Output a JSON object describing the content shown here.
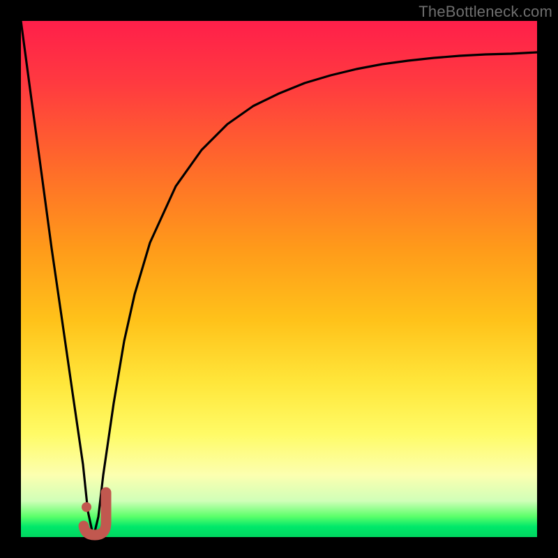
{
  "watermark": "TheBottleneck.com",
  "colors": {
    "frame": "#000000",
    "curve": "#000000",
    "marker": "#c1584f",
    "gradient_top": "#ff1f4a",
    "gradient_bottom": "#00d660"
  },
  "chart_data": {
    "type": "line",
    "title": "",
    "xlabel": "",
    "ylabel": "",
    "xlim": [
      0,
      100
    ],
    "ylim": [
      0,
      100
    ],
    "grid": false,
    "legend": false,
    "series": [
      {
        "name": "bottleneck-curve",
        "x": [
          0,
          2,
          4,
          6,
          8,
          10,
          12,
          13,
          14,
          15,
          16,
          18,
          20,
          22,
          25,
          30,
          35,
          40,
          45,
          50,
          55,
          60,
          65,
          70,
          75,
          80,
          85,
          90,
          95,
          100
        ],
        "y": [
          100,
          85,
          70,
          56,
          42,
          28,
          14,
          5,
          0,
          4,
          12,
          26,
          38,
          47,
          57,
          68,
          75,
          80,
          83.5,
          86,
          88,
          89.5,
          90.7,
          91.6,
          92.3,
          92.8,
          93.2,
          93.5,
          93.7,
          93.9
        ]
      }
    ],
    "marker": {
      "name": "j-marker",
      "shape": "J",
      "color": "#c1584f",
      "position_x": 14.5,
      "position_y": 3
    },
    "gradient_bands": [
      {
        "label": "red",
        "y_from": 100,
        "y_to": 60
      },
      {
        "label": "orange",
        "y_from": 60,
        "y_to": 35
      },
      {
        "label": "yellow",
        "y_from": 35,
        "y_to": 12
      },
      {
        "label": "green",
        "y_from": 12,
        "y_to": 0
      }
    ]
  }
}
